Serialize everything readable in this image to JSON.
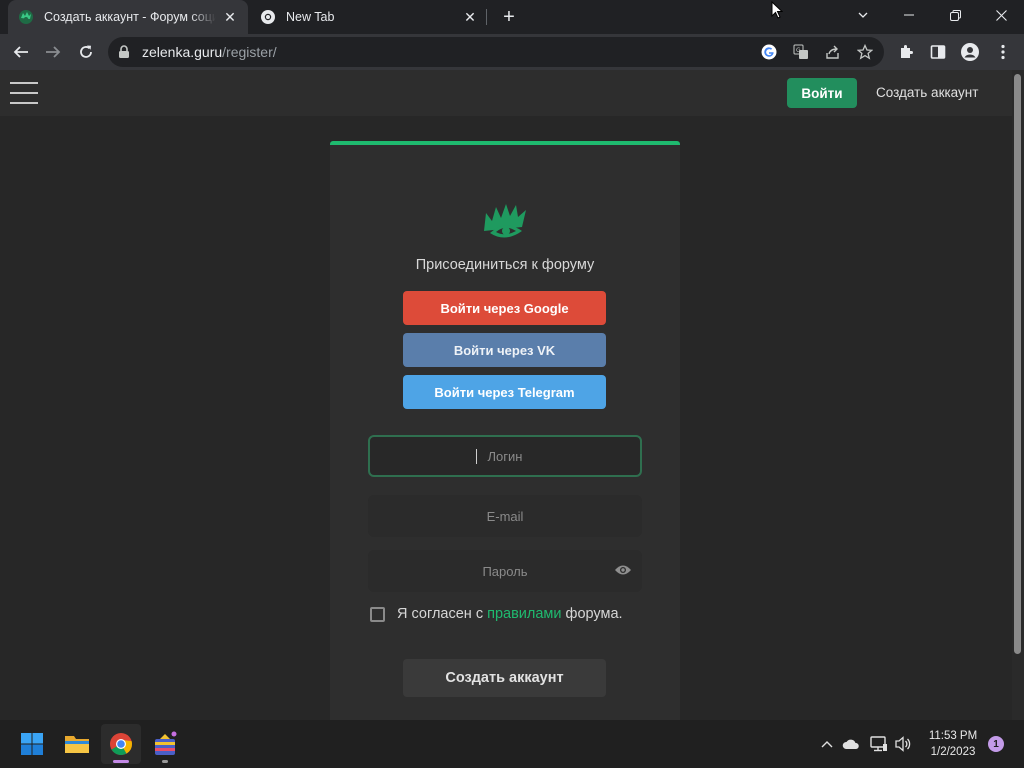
{
  "browser": {
    "tabs": [
      {
        "title": "Создать аккаунт - Форум социальной инженерии",
        "active": true
      },
      {
        "title": "New Tab",
        "active": false
      }
    ],
    "url_host": "zelenka.guru",
    "url_path": "/register/"
  },
  "header": {
    "login_label": "Войти",
    "register_label": "Создать аккаунт"
  },
  "form": {
    "title": "Присоединиться к форуму",
    "google_label": "Войти через Google",
    "vk_label": "Войти через VK",
    "telegram_label": "Войти через Telegram",
    "login_placeholder": "Логин",
    "email_placeholder": "E-mail",
    "password_placeholder": "Пароль",
    "agree_prefix": "Я согласен с ",
    "agree_link": "правилами",
    "agree_suffix": " форума.",
    "submit_label": "Создать аккаунт"
  },
  "taskbar": {
    "time": "11:53 PM",
    "date": "1/2/2023",
    "notification_count": "1"
  },
  "colors": {
    "accent_green": "#1fba6f",
    "login_button": "#228e5d",
    "google": "#dd4b39",
    "vk": "#5a7eab",
    "telegram": "#4ea4e6"
  }
}
